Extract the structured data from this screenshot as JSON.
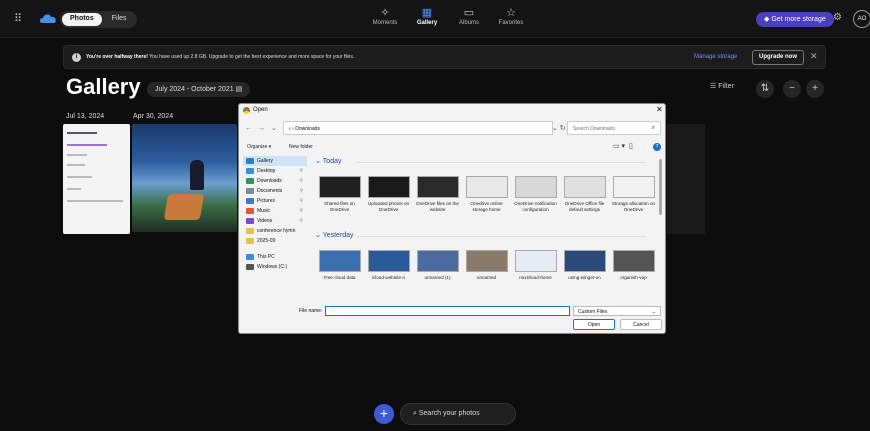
{
  "topbar": {
    "tabs": [
      "Photos",
      "Files"
    ],
    "nav": [
      {
        "label": "Moments",
        "icon": "moments-icon"
      },
      {
        "label": "Gallery",
        "icon": "gallery-icon",
        "active": true
      },
      {
        "label": "Albums",
        "icon": "albums-icon"
      },
      {
        "label": "Favorites",
        "icon": "star-icon"
      }
    ],
    "storage_button": "Get more storage",
    "avatar": "AO"
  },
  "banner": {
    "bold": "You're over halfway there!",
    "text": "You have used up 2.8 GB. Upgrade to get the best experience and more space for your files.",
    "manage": "Manage storage",
    "upgrade": "Upgrade now"
  },
  "gallery": {
    "title": "Gallery",
    "range": "July 2024 - October 2021",
    "filter": "Filter",
    "dates": [
      "Jul 13, 2024",
      "Apr 30, 2024"
    ]
  },
  "dialog": {
    "title": "Open",
    "breadcrumb": "Downloads",
    "search_placeholder": "Search Downloads",
    "organize": "Organize ▾",
    "new_folder": "New folder",
    "sidebar": [
      {
        "label": "Gallery",
        "color": "#2a7fd4",
        "selected": true
      },
      {
        "label": "Desktop",
        "color": "#3a8fe0",
        "pin": true
      },
      {
        "label": "Downloads",
        "color": "#2a9a5a",
        "pin": true
      },
      {
        "label": "Documents",
        "color": "#7a8aa0",
        "pin": true
      },
      {
        "label": "Pictures",
        "color": "#3a7ad0",
        "pin": true
      },
      {
        "label": "Music",
        "color": "#e05a3a",
        "pin": true
      },
      {
        "label": "Videos",
        "color": "#7a4ad0",
        "pin": true
      },
      {
        "label": "conference hymn",
        "color": "#e8c04a"
      },
      {
        "label": "2025-09",
        "color": "#e8c04a"
      },
      {
        "label": "This PC",
        "color": "#3a8fe0",
        "gap": true
      },
      {
        "label": "Windows (C:)",
        "color": "#555"
      }
    ],
    "groups": [
      {
        "label": "Today",
        "files": [
          {
            "name": "Shared files on OneDrive",
            "thumb": "#202020"
          },
          {
            "name": "Uploaded photos on OneDrive",
            "thumb": "#1a1a1a"
          },
          {
            "name": "OneDrive files on the website",
            "thumb": "#2a2a2a"
          },
          {
            "name": "Onedrive online storage home",
            "thumb": "#e8e8e8"
          },
          {
            "name": "OneDrive notification configuration",
            "thumb": "#d8d8d8"
          },
          {
            "name": "OneDrive Office file default settings",
            "thumb": "#e0e0e0"
          },
          {
            "name": "Storage allocation on OneDrive",
            "thumb": "#f2f2f2"
          }
        ]
      },
      {
        "label": "Yesterday",
        "files": [
          {
            "name": "Free cloud data",
            "thumb": "#3a6fb0"
          },
          {
            "name": "icloud-website-o",
            "thumb": "#2a5a9a"
          },
          {
            "name": "unnamed (1)",
            "thumb": "#4a6aa0"
          },
          {
            "name": "unnamed",
            "thumb": "#8a7a6a"
          },
          {
            "name": "nextcloud-home",
            "thumb": "#e6ecf4"
          },
          {
            "name": "using-winget-on",
            "thumb": "#2a4a7a"
          },
          {
            "name": "organish-vop",
            "thumb": "#555555"
          }
        ]
      }
    ],
    "filename_label": "File name:",
    "filetype": "Custom Files",
    "open": "Open",
    "cancel": "Cancel"
  },
  "bottom": {
    "search": "Search your photos"
  }
}
